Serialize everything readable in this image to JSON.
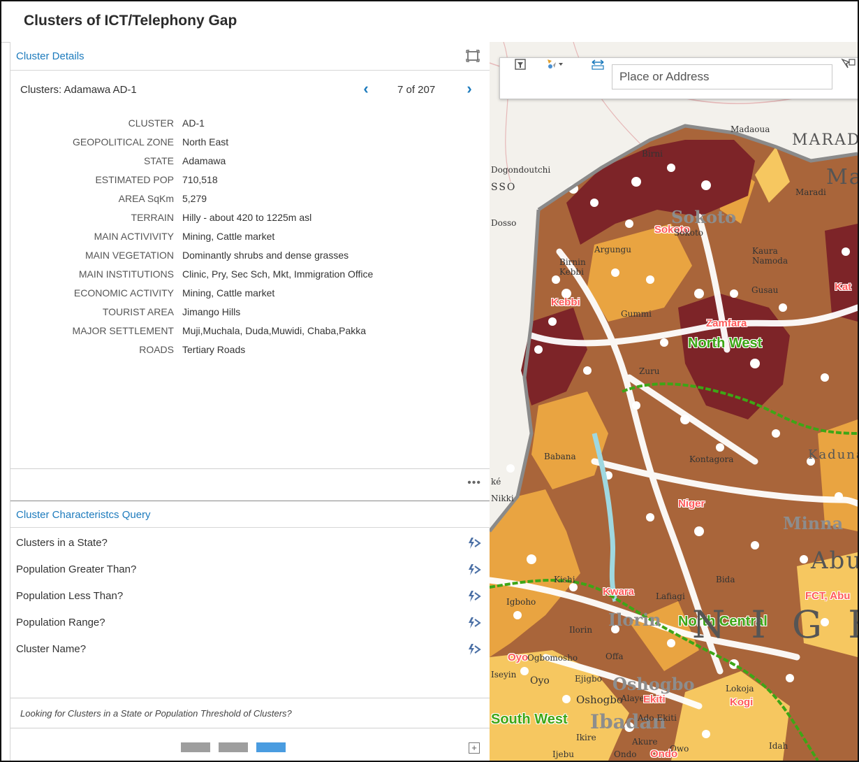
{
  "app": {
    "title": "Clusters of ICT/Telephony Gap"
  },
  "cluster_details": {
    "title": "Cluster Details",
    "record_label": "Clusters: Adamawa AD-1",
    "pagination": "7 of 207",
    "fields": [
      {
        "key": "CLUSTER",
        "value": "AD-1"
      },
      {
        "key": "GEOPOLITICAL ZONE",
        "value": "North East"
      },
      {
        "key": "STATE",
        "value": "Adamawa"
      },
      {
        "key": "ESTIMATED POP",
        "value": "710,518"
      },
      {
        "key": "AREA SqKm",
        "value": "5,279"
      },
      {
        "key": "TERRAIN",
        "value": "Hilly - about 420 to 1225m asl"
      },
      {
        "key": "MAIN ACTIVIVITY",
        "value": "Mining, Cattle market"
      },
      {
        "key": "MAIN VEGETATION",
        "value": "Dominantly shrubs and dense grasses"
      },
      {
        "key": "MAIN INSTITUTIONS",
        "value": "Clinic, Pry, Sec Sch, Mkt, Immigration Office"
      },
      {
        "key": "ECONOMIC ACTIVITY",
        "value": "Mining, Cattle market"
      },
      {
        "key": "TOURIST AREA",
        "value": "Jimango Hills"
      },
      {
        "key": "MAJOR SETTLEMENT",
        "value": "Muji,Muchala, Duda,Muwidi, Chaba,Pakka"
      },
      {
        "key": "ROADS",
        "value": "Tertiary Roads"
      }
    ],
    "more": "•••"
  },
  "query_panel": {
    "title": "Cluster Characteristcs Query",
    "items": [
      {
        "label": "Clusters in a State?"
      },
      {
        "label": "Population Greater Than?"
      },
      {
        "label": "Population Less Than?"
      },
      {
        "label": "Population Range?"
      },
      {
        "label": "Cluster Name?"
      }
    ],
    "hint": "Looking for Clusters in a State or Population Threshold of Clusters?"
  },
  "pager": {
    "pages": 3,
    "active_index": 2
  },
  "map": {
    "search_placeholder": "Place or Address",
    "labels": {
      "madaoua": "Madaoua",
      "marad_big": "MARAD",
      "ma_big": "Ma",
      "birni": "Birni",
      "dogondoutchi": "Dogondoutchi",
      "sso": "SSO",
      "maradi": "Maradi",
      "dosso": "Dosso",
      "sokoto_grey": "Sokoto",
      "sokoto_state": "Sokoto",
      "sokoto_town": "Sokoto",
      "argungu": "Argungu",
      "birnin_kebbi": "Birnin Kebbi",
      "kaura_namoda": "Kaura Namoda",
      "kebbi": "Kebbi",
      "gummi": "Gummi",
      "gusau": "Gusau",
      "zamfara": "Zamfara",
      "north_west": "North West",
      "kat": "Kat",
      "zuru": "Zuru",
      "babana": "Babana",
      "kontagora": "Kontagora",
      "kaduna": "Kaduna",
      "ke": "ké",
      "nikki": "Nikki",
      "niger": "Niger",
      "minna": "Minna",
      "abu_big": "Abu",
      "kishi": "Kishi",
      "bida": "Bida",
      "kwara": "Kwara",
      "lafiagi": "Lafiagi",
      "fct_abu": "FCT, Abu",
      "igboho": "Igboho",
      "ilorin_grey": "Ilorin",
      "ilorin": "Ilorin",
      "north_central": "North Central",
      "nige_big": "N I G E",
      "oyo_state": "Oyo",
      "ogbomosho": "Ogbomosho",
      "offa": "Offa",
      "iseyin": "Iseyin",
      "oyo": "Oyo",
      "ejigbo": "Ejigbo",
      "osogbo_grey": "Oshogbo",
      "oshogbo": "Oshogbo",
      "alaye": "Alaye",
      "ekiti": "Ekiti",
      "lokoja": "Lokoja",
      "kogi": "Kogi",
      "south_west": "South West",
      "ibadan": "Ibadan",
      "ado_ekiti": "Ado Ekiti",
      "ikire": "Ikire",
      "akure": "Akure",
      "owo": "Owo",
      "ijebu": "Ijebu",
      "ondo": "Ondo",
      "ondo_state": "Ondo",
      "idah": "Idah"
    }
  },
  "colors": {
    "accent_blue": "#1d7bbd",
    "class_dark": "#7d2428",
    "class_brown": "#a9653a",
    "class_orange": "#e9a441",
    "class_light": "#f6c760",
    "zone_border": "#3da616",
    "state_label": "#ff5a5a"
  }
}
